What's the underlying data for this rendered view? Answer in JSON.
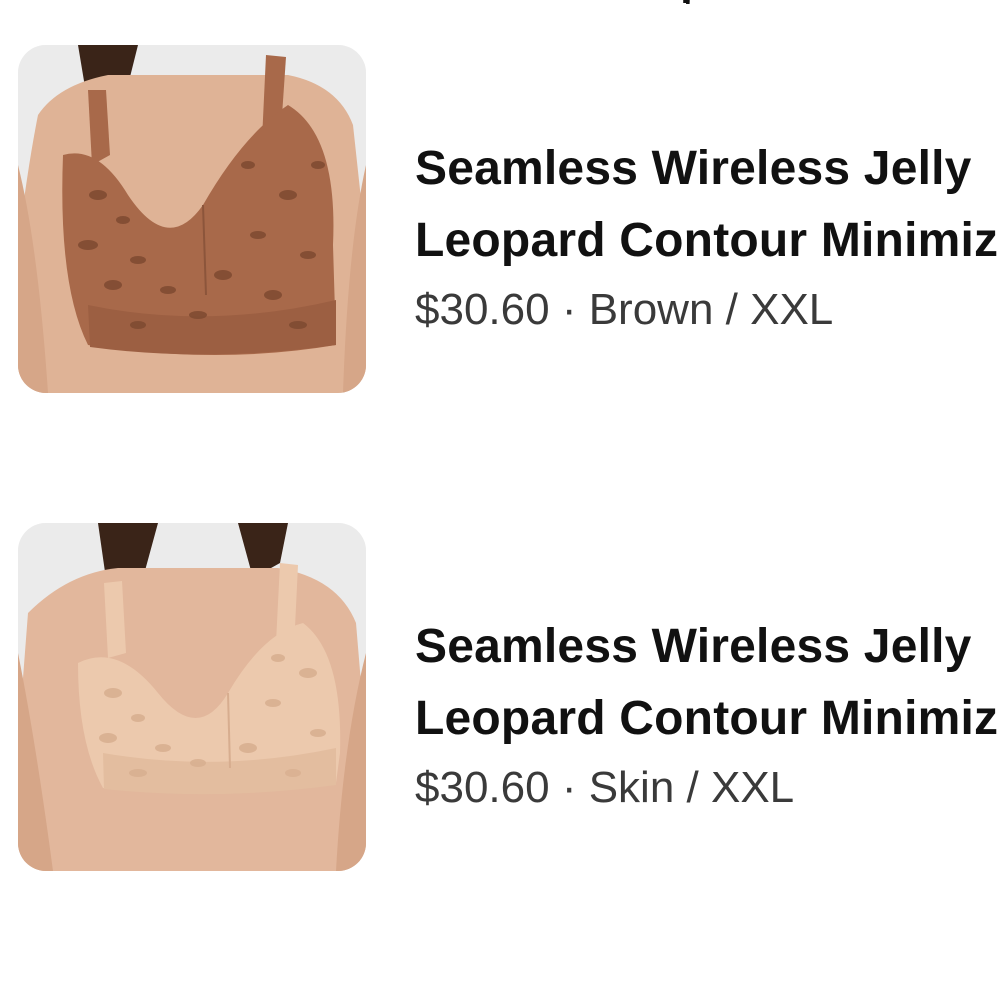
{
  "top_fragment": ",",
  "items": [
    {
      "title_line1": "Seamless Wireless Jelly",
      "title_line2": "Leopard Contour Minimizer",
      "price": "$30.60",
      "separator": "·",
      "variant": "Brown / XXL",
      "image_alt": "Brown leopard print wireless bra product photo",
      "colors": {
        "fabric": "#a8694a",
        "spot": "#7e4a31",
        "skin": "#e2b79c",
        "bg": "#ededed"
      }
    },
    {
      "title_line1": "Seamless Wireless Jelly",
      "title_line2": "Leopard Contour Minimizer",
      "price": "$30.60",
      "separator": "·",
      "variant": "Skin / XXL",
      "image_alt": "Skin tone leopard print wireless bra product photo",
      "colors": {
        "fabric": "#ecc9ad",
        "spot": "#d9b091",
        "skin": "#e4b99e",
        "bg": "#ededed"
      }
    }
  ]
}
